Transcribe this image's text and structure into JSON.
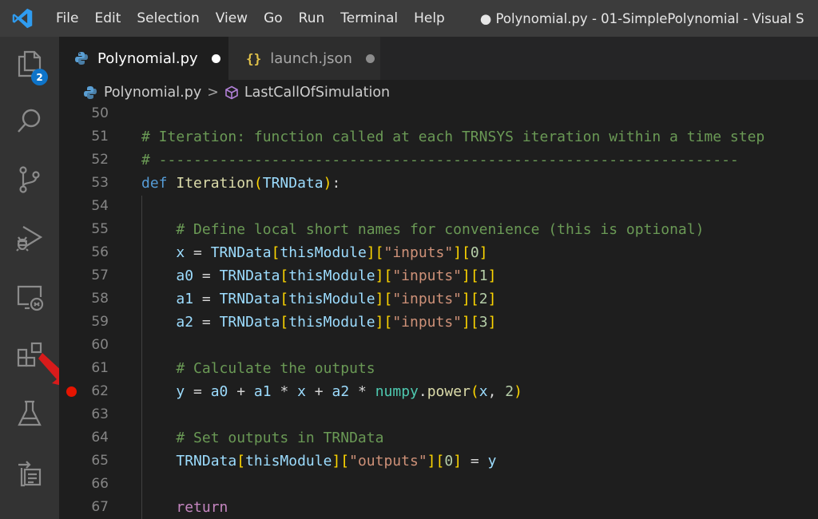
{
  "titlebar": {
    "menu": [
      "File",
      "Edit",
      "Selection",
      "View",
      "Go",
      "Run",
      "Terminal",
      "Help"
    ],
    "window_title": "● Polynomial.py - 01-SimplePolynomial - Visual S"
  },
  "activitybar": {
    "explorer_badge": "2",
    "icons": [
      "explorer-icon",
      "search-icon",
      "source-control-icon",
      "run-debug-icon",
      "remote-explorer-icon",
      "extensions-icon",
      "testing-icon",
      "tasks-icon"
    ]
  },
  "tabs": [
    {
      "label": "Polynomial.py",
      "icon": "python-icon",
      "active": true,
      "modified": true
    },
    {
      "label": "launch.json",
      "icon": "json-braces-icon",
      "active": false,
      "modified": true
    }
  ],
  "breadcrumb": {
    "file": "Polynomial.py",
    "separator": ">",
    "symbol": "LastCallOfSimulation"
  },
  "editor": {
    "breakpoint_line": "62",
    "lines": [
      {
        "n": "50"
      },
      {
        "n": "51"
      },
      {
        "n": "52"
      },
      {
        "n": "53"
      },
      {
        "n": "54"
      },
      {
        "n": "55"
      },
      {
        "n": "56"
      },
      {
        "n": "57"
      },
      {
        "n": "58"
      },
      {
        "n": "59"
      },
      {
        "n": "60"
      },
      {
        "n": "61"
      },
      {
        "n": "62"
      },
      {
        "n": "63"
      },
      {
        "n": "64"
      },
      {
        "n": "65"
      },
      {
        "n": "66"
      },
      {
        "n": "67"
      }
    ],
    "tokens": {
      "l51": [
        [
          "c-cmt",
          "# Iteration: function called at each TRNSYS iteration within a time step"
        ]
      ],
      "l52": [
        [
          "c-cmt",
          "# -------------------------------------------------------------------"
        ]
      ],
      "l53": [
        [
          "c-kw",
          "def"
        ],
        [
          "c-op",
          " "
        ],
        [
          "c-fn",
          "Iteration"
        ],
        [
          "c-b1",
          "("
        ],
        [
          "c-var",
          "TRNData"
        ],
        [
          "c-b1",
          ")"
        ],
        [
          "c-op",
          ":"
        ]
      ],
      "l55": [
        [
          "c-op",
          "    "
        ],
        [
          "c-cmt",
          "# Define local short names for convenience (this is optional)"
        ]
      ],
      "l56": [
        [
          "c-op",
          "    "
        ],
        [
          "c-var",
          "x"
        ],
        [
          "c-op",
          " = "
        ],
        [
          "c-var",
          "TRNData"
        ],
        [
          "c-b1",
          "["
        ],
        [
          "c-var",
          "thisModule"
        ],
        [
          "c-b1",
          "]"
        ],
        [
          "c-b1",
          "["
        ],
        [
          "c-str",
          "\"inputs\""
        ],
        [
          "c-b1",
          "]"
        ],
        [
          "c-b1",
          "["
        ],
        [
          "c-num",
          "0"
        ],
        [
          "c-b1",
          "]"
        ]
      ],
      "l57": [
        [
          "c-op",
          "    "
        ],
        [
          "c-var",
          "a0"
        ],
        [
          "c-op",
          " = "
        ],
        [
          "c-var",
          "TRNData"
        ],
        [
          "c-b1",
          "["
        ],
        [
          "c-var",
          "thisModule"
        ],
        [
          "c-b1",
          "]"
        ],
        [
          "c-b1",
          "["
        ],
        [
          "c-str",
          "\"inputs\""
        ],
        [
          "c-b1",
          "]"
        ],
        [
          "c-b1",
          "["
        ],
        [
          "c-num",
          "1"
        ],
        [
          "c-b1",
          "]"
        ]
      ],
      "l58": [
        [
          "c-op",
          "    "
        ],
        [
          "c-var",
          "a1"
        ],
        [
          "c-op",
          " = "
        ],
        [
          "c-var",
          "TRNData"
        ],
        [
          "c-b1",
          "["
        ],
        [
          "c-var",
          "thisModule"
        ],
        [
          "c-b1",
          "]"
        ],
        [
          "c-b1",
          "["
        ],
        [
          "c-str",
          "\"inputs\""
        ],
        [
          "c-b1",
          "]"
        ],
        [
          "c-b1",
          "["
        ],
        [
          "c-num",
          "2"
        ],
        [
          "c-b1",
          "]"
        ]
      ],
      "l59": [
        [
          "c-op",
          "    "
        ],
        [
          "c-var",
          "a2"
        ],
        [
          "c-op",
          " = "
        ],
        [
          "c-var",
          "TRNData"
        ],
        [
          "c-b1",
          "["
        ],
        [
          "c-var",
          "thisModule"
        ],
        [
          "c-b1",
          "]"
        ],
        [
          "c-b1",
          "["
        ],
        [
          "c-str",
          "\"inputs\""
        ],
        [
          "c-b1",
          "]"
        ],
        [
          "c-b1",
          "["
        ],
        [
          "c-num",
          "3"
        ],
        [
          "c-b1",
          "]"
        ]
      ],
      "l61": [
        [
          "c-op",
          "    "
        ],
        [
          "c-cmt",
          "# Calculate the outputs"
        ]
      ],
      "l62": [
        [
          "c-op",
          "    "
        ],
        [
          "c-var",
          "y"
        ],
        [
          "c-op",
          " = "
        ],
        [
          "c-var",
          "a0"
        ],
        [
          "c-op",
          " + "
        ],
        [
          "c-var",
          "a1"
        ],
        [
          "c-op",
          " * "
        ],
        [
          "c-var",
          "x"
        ],
        [
          "c-op",
          " + "
        ],
        [
          "c-var",
          "a2"
        ],
        [
          "c-op",
          " * "
        ],
        [
          "c-ty",
          "numpy"
        ],
        [
          "c-op",
          "."
        ],
        [
          "c-fn",
          "power"
        ],
        [
          "c-b1",
          "("
        ],
        [
          "c-var",
          "x"
        ],
        [
          "c-op",
          ", "
        ],
        [
          "c-num",
          "2"
        ],
        [
          "c-b1",
          ")"
        ]
      ],
      "l64": [
        [
          "c-op",
          "    "
        ],
        [
          "c-cmt",
          "# Set outputs in TRNData"
        ]
      ],
      "l65": [
        [
          "c-op",
          "    "
        ],
        [
          "c-var",
          "TRNData"
        ],
        [
          "c-b1",
          "["
        ],
        [
          "c-var",
          "thisModule"
        ],
        [
          "c-b1",
          "]"
        ],
        [
          "c-b1",
          "["
        ],
        [
          "c-str",
          "\"outputs\""
        ],
        [
          "c-b1",
          "]"
        ],
        [
          "c-b1",
          "["
        ],
        [
          "c-num",
          "0"
        ],
        [
          "c-b1",
          "]"
        ],
        [
          "c-op",
          " = "
        ],
        [
          "c-var",
          "y"
        ]
      ],
      "l67": [
        [
          "c-op",
          "    "
        ],
        [
          "c-ctl",
          "return"
        ]
      ]
    }
  },
  "colors": {
    "accent": "#0e74c9",
    "breakpoint": "#e51400",
    "annotation_arrow": "#d81b1b"
  }
}
